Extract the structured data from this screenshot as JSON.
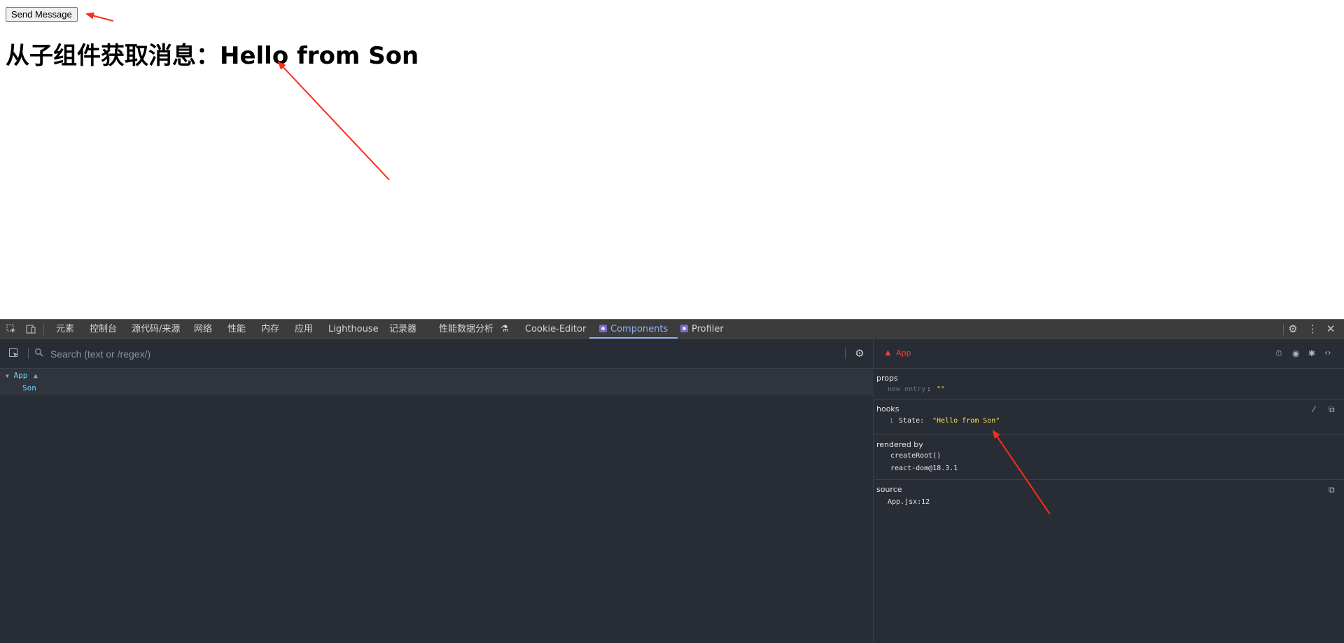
{
  "page": {
    "send_button_label": "Send Message",
    "heading": "从子组件获取消息：Hello from Son"
  },
  "devtools": {
    "tabs": [
      "元素",
      "控制台",
      "源代码/来源",
      "网络",
      "性能",
      "内存",
      "应用",
      "Lighthouse",
      "记录器",
      "性能数据分析",
      "Cookie-Editor",
      "Components",
      "Profiler"
    ],
    "active_tab": "Components",
    "icons": {
      "inspect": "inspect-element-icon",
      "device": "device-toolbar-icon",
      "settings": "gear-icon",
      "more": "more-vertical-icon",
      "close": "close-icon"
    }
  },
  "components_panel": {
    "search_placeholder": "Search (text or /regex/)",
    "tree": [
      {
        "name": "App",
        "warning": true
      },
      {
        "name": "Son",
        "warning": false
      }
    ]
  },
  "inspector": {
    "component_name": "App",
    "props": {
      "title": "props",
      "new_entry_label": "new entry",
      "new_entry_value": "\"\""
    },
    "hooks": {
      "title": "hooks",
      "index": "1",
      "name": "State:",
      "value": "\"Hello from Son\""
    },
    "rendered_by": {
      "title": "rendered by",
      "items": [
        "createRoot()",
        "react-dom@18.3.1"
      ]
    },
    "source": {
      "title": "source",
      "file": "App.jsx:12"
    }
  },
  "colors": {
    "accent_blue": "#8ab4f8",
    "component_cyan": "#61dafb",
    "warning_red": "#ef4343",
    "string_yellow": "#f4e04d",
    "devtools_bg": "#282c34",
    "annotation_red": "#ff2a1a"
  }
}
